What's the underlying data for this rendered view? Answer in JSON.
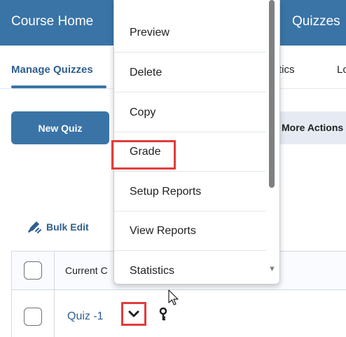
{
  "nav": {
    "course_home": "Course Home",
    "quizzes": "Quizzes"
  },
  "tabs": {
    "manage": "Manage Quizzes",
    "statistics": "tistics",
    "lo": "Lo"
  },
  "actions": {
    "new_quiz": "New Quiz",
    "more_actions": "More Actions"
  },
  "bulk_edit": {
    "label": "Bulk Edit",
    "icon": "pencil-icon"
  },
  "table": {
    "header": "Current C",
    "rows": [
      {
        "title": "Quiz -1"
      }
    ]
  },
  "menu": {
    "items": [
      "Preview",
      "Delete",
      "Copy",
      "Grade",
      "Setup Reports",
      "View Reports",
      "Statistics"
    ],
    "highlighted": "Grade"
  },
  "colors": {
    "brand": "#3a74a6",
    "link": "#2f5f8f",
    "highlight": "#e23c3c"
  }
}
